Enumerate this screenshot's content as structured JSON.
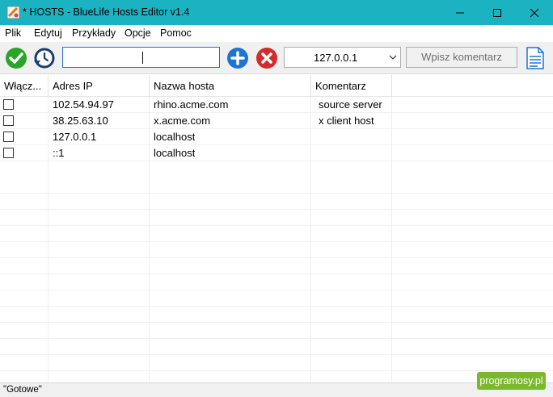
{
  "window": {
    "title": "* HOSTS - BlueLife Hosts Editor v1.4"
  },
  "menu": [
    "Plik",
    "Edytuj",
    "Przykłady",
    "Opcje",
    "Pomoc"
  ],
  "toolbar": {
    "ip_input_value": "",
    "ip_combo_value": "127.0.0.1",
    "comment_placeholder": "Wpisz komentarz"
  },
  "table": {
    "columns": [
      "Włącz...",
      "Adres IP",
      "Nazwa hosta",
      "Komentarz"
    ],
    "rows": [
      {
        "enabled": false,
        "ip": "102.54.94.97",
        "host": "rhino.acme.com",
        "comment": "source server"
      },
      {
        "enabled": false,
        "ip": "38.25.63.10",
        "host": "x.acme.com",
        "comment": "x client host"
      },
      {
        "enabled": false,
        "ip": "127.0.0.1",
        "host": "localhost",
        "comment": ""
      },
      {
        "enabled": false,
        "ip": "::1",
        "host": "localhost",
        "comment": ""
      }
    ]
  },
  "status": {
    "text": "\"Gotowe\""
  },
  "watermark": {
    "text": "programosy.pl"
  },
  "colors": {
    "titlebar": "#1bb3c1",
    "accept_green": "#2aa52a",
    "add_blue": "#1e74d0",
    "delete_red": "#d32b2b",
    "watermark_green": "#7ab82c"
  },
  "icons": {
    "app": "app-icon",
    "apply": "checkmark-icon",
    "restore": "clock-restore-icon",
    "add": "plus-circle-icon",
    "remove": "x-circle-icon",
    "document": "document-icon"
  }
}
